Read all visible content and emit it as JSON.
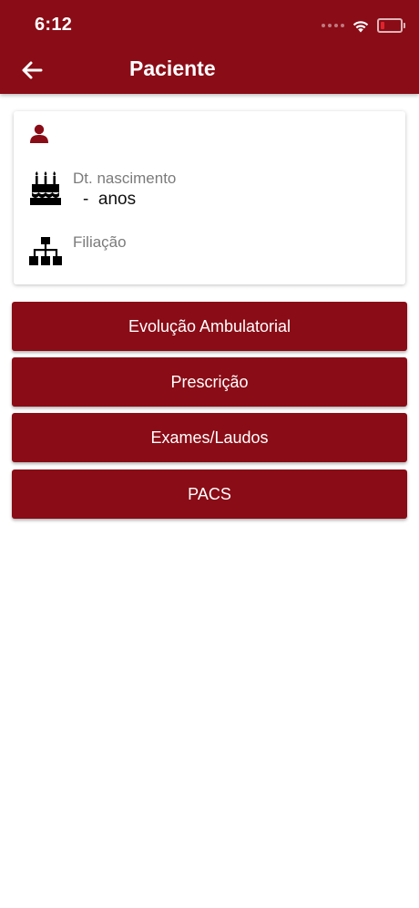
{
  "status_bar": {
    "time": "6:12",
    "battery_level": 0.2,
    "icons": [
      "signal-dots-icon",
      "wifi-icon",
      "battery-icon"
    ]
  },
  "header": {
    "title": "Paciente",
    "back_icon": "arrow-left-icon"
  },
  "patient": {
    "name": "",
    "birth_label": "Dt. nascimento",
    "birth_value": "-  anos",
    "filiation_label": "Filiação",
    "icons": [
      "person-icon",
      "birthday-cake-icon",
      "sitemap-icon"
    ]
  },
  "menu": {
    "items": [
      {
        "label": "Evolução Ambulatorial"
      },
      {
        "label": "Prescrição"
      },
      {
        "label": "Exames/Laudos"
      },
      {
        "label": "PACS"
      }
    ]
  },
  "colors": {
    "primary": "#8a0c16",
    "text_grey": "#7b7b7b",
    "battery_low": "#e0242d"
  }
}
